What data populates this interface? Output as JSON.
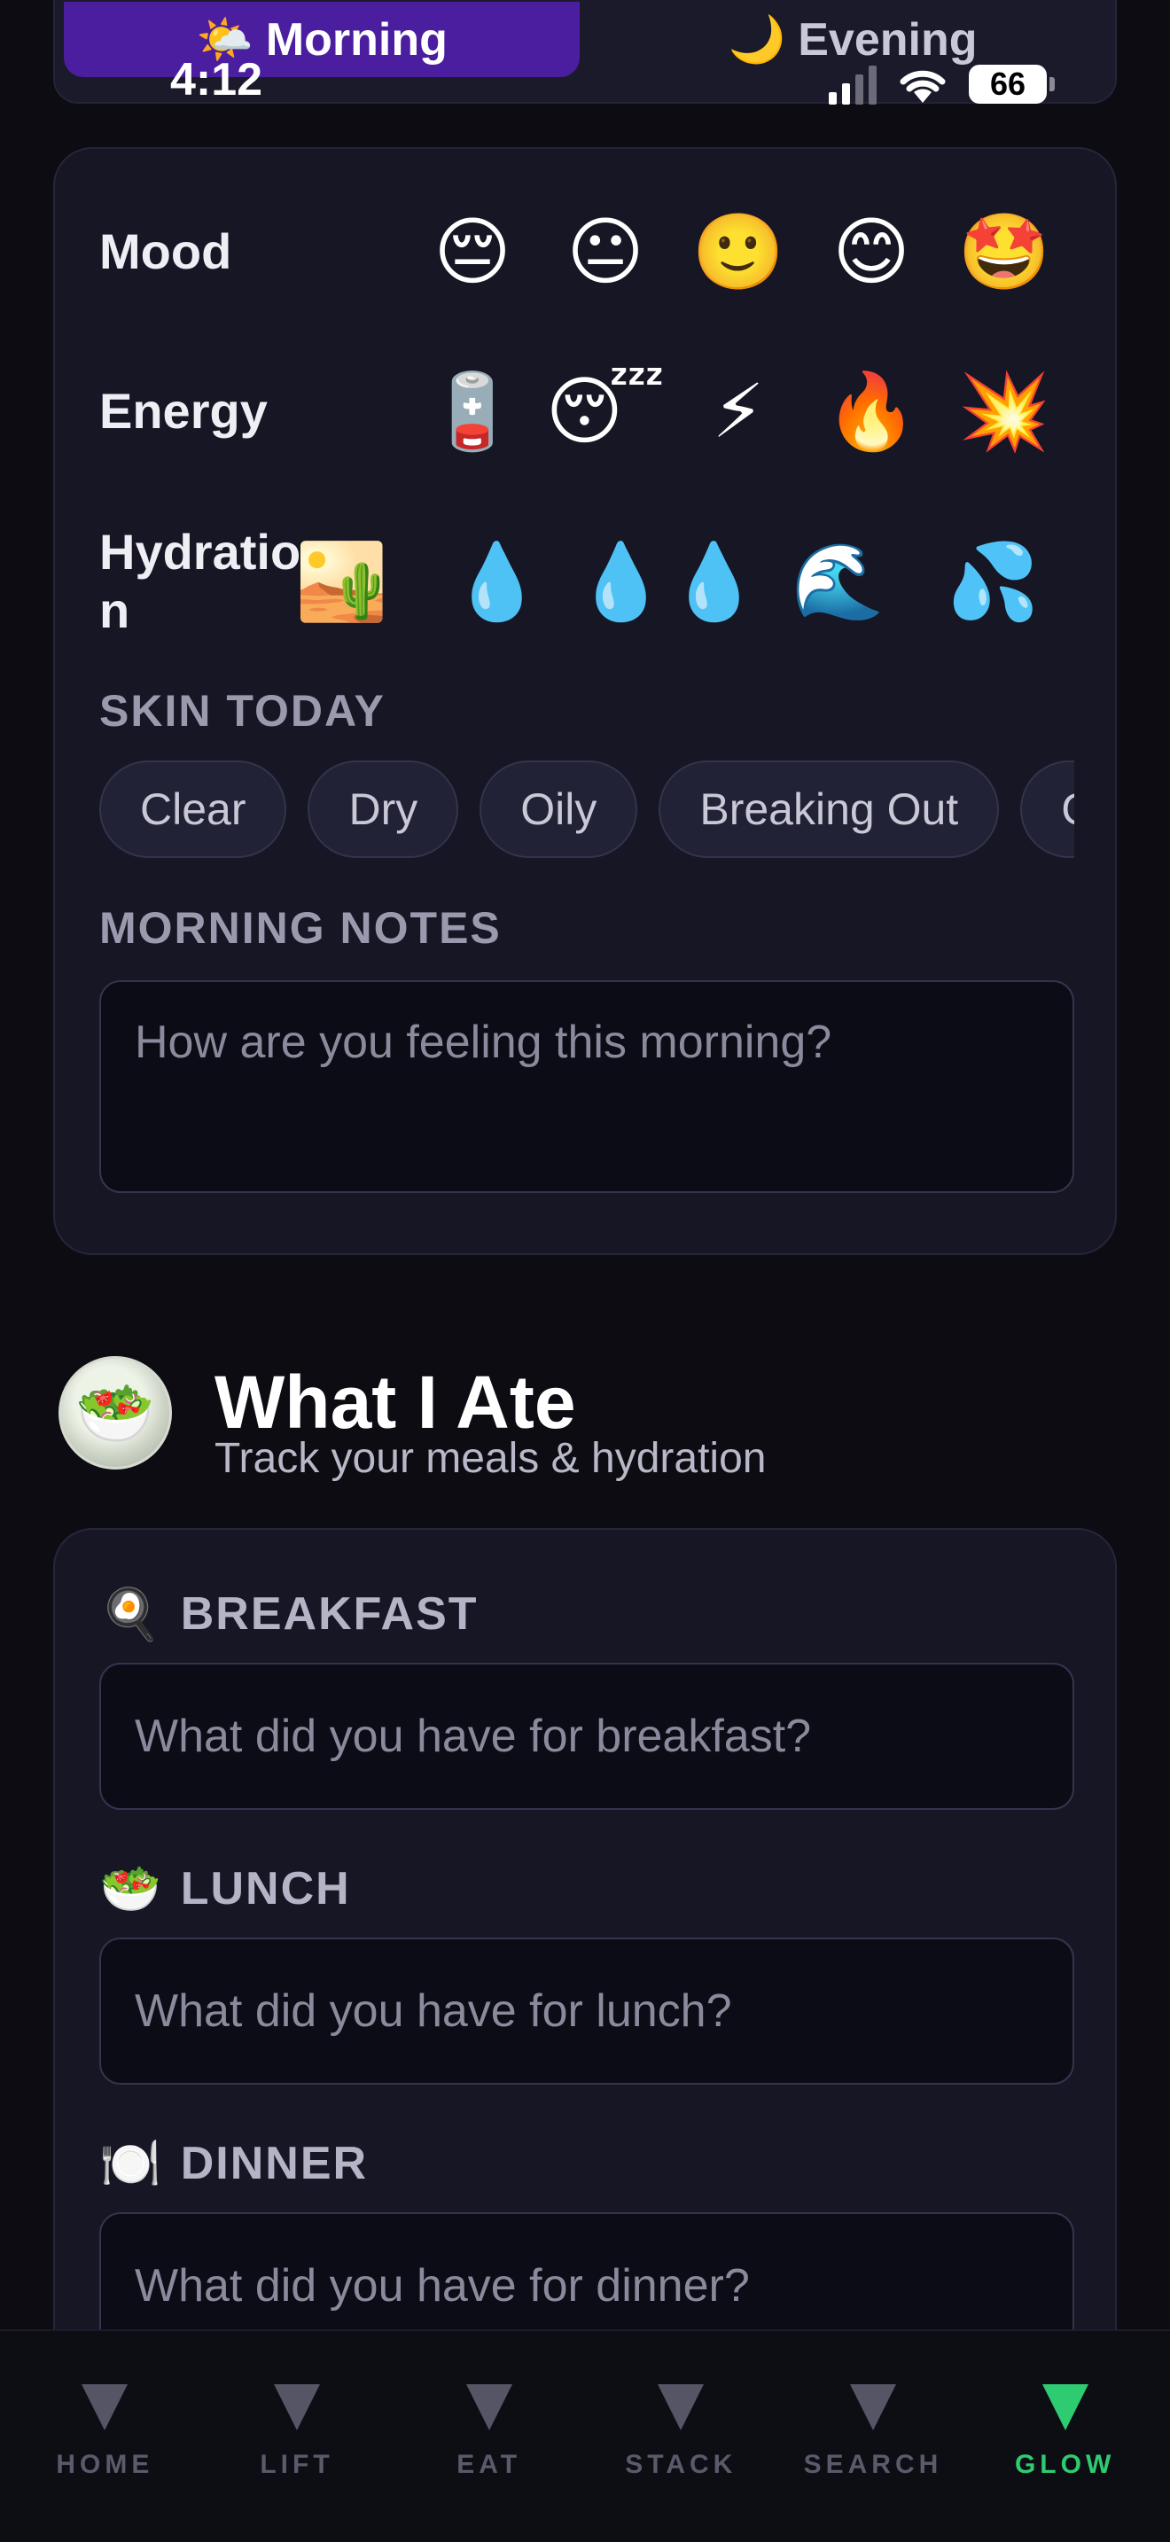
{
  "status_bar": {
    "time": "4:12",
    "battery": "66"
  },
  "segment": {
    "morning": {
      "emoji": "🌤️",
      "label": "Morning"
    },
    "evening": {
      "emoji": "🌙",
      "label": "Evening"
    }
  },
  "checkin": {
    "mood": {
      "label": "Mood",
      "options": [
        "😔",
        "😐",
        "🙂",
        "😊",
        "🤩"
      ]
    },
    "energy": {
      "label": "Energy",
      "options": [
        "🪫",
        "😴",
        "⚡",
        "🔥",
        "💥"
      ]
    },
    "hydration": {
      "label": "Hydratio n",
      "options": [
        "🏜️",
        "💧",
        "💧💧",
        "🌊",
        "💦"
      ]
    },
    "skin": {
      "label": "SKIN TODAY",
      "chips": [
        "Clear",
        "Dry",
        "Oily",
        "Breaking Out",
        "Glowing"
      ]
    },
    "notes": {
      "label": "MORNING NOTES",
      "placeholder": "How are you feeling this morning?"
    }
  },
  "ate": {
    "icon": "🥗",
    "title": "What I Ate",
    "subtitle": "Track your meals & hydration",
    "meals": {
      "breakfast": {
        "emoji": "🍳",
        "label": "BREAKFAST",
        "placeholder": "What did you have for breakfast?"
      },
      "lunch": {
        "emoji": "🥗",
        "label": "LUNCH",
        "placeholder": "What did you have for lunch?"
      },
      "dinner": {
        "emoji": "🍽️",
        "label": "DINNER",
        "placeholder": "What did you have for dinner?"
      }
    }
  },
  "nav": {
    "home": "HOME",
    "lift": "LIFT",
    "eat": "EAT",
    "stack": "STACK",
    "search": "SEARCH",
    "glow": "GLOW",
    "active_color": "#2ecc71"
  }
}
